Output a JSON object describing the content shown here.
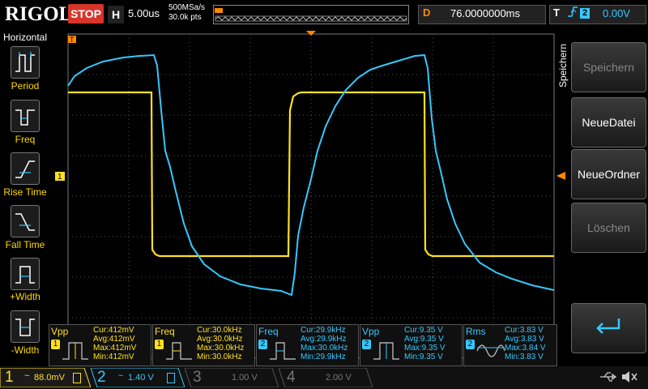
{
  "header": {
    "brand": "RIGOL",
    "run_state": "STOP",
    "timebase_label": "H",
    "timebase": "5.00us",
    "sample_rate": "500MSa/s",
    "memory_depth": "30.0k pts",
    "delay_label": "D",
    "delay_value": "76.0000000ms",
    "trigger_label": "T",
    "trigger_source": "2",
    "trigger_level": "0.00V"
  },
  "left_menu": {
    "title": "Horizontal",
    "items": [
      {
        "label": "Period",
        "icon": "period-icon"
      },
      {
        "label": "Freq",
        "icon": "frequency-icon"
      },
      {
        "label": "Rise Time",
        "icon": "rise-time-icon"
      },
      {
        "label": "Fall Time",
        "icon": "fall-time-icon"
      },
      {
        "label": "+Width",
        "icon": "positive-width-icon"
      },
      {
        "label": "-Width",
        "icon": "negative-width-icon"
      }
    ]
  },
  "right_menu": {
    "title": "Speichern",
    "items": [
      {
        "label": "Speichern",
        "enabled": false
      },
      {
        "label": "NeueDatei",
        "enabled": true
      },
      {
        "label": "NeueOrdner",
        "enabled": true
      },
      {
        "label": "Löschen",
        "enabled": false
      }
    ],
    "return_icon": "return-arrow-icon"
  },
  "markers": {
    "ch1_ref": "1",
    "trig_pos": "T"
  },
  "measurements": [
    {
      "name": "Vpp",
      "ch": "1",
      "cur": "Cur:412mV",
      "avg": "Avg:412mV",
      "max": "Max:412mV",
      "min": "Min:412mV",
      "icon": "vpp-icon"
    },
    {
      "name": "Freq",
      "ch": "1",
      "cur": "Cur:30.0kHz",
      "avg": "Avg:30.0kHz",
      "max": "Max:30.0kHz",
      "min": "Min:30.0kHz",
      "icon": "freq-icon"
    },
    {
      "name": "Freq",
      "ch": "2",
      "cur": "Cur:29.9kHz",
      "avg": "Avg:29.9kHz",
      "max": "Max:30.0kHz",
      "min": "Min:29.9kHz",
      "icon": "freq-icon"
    },
    {
      "name": "Vpp",
      "ch": "2",
      "cur": "Cur:9.35 V",
      "avg": "Avg:9.35 V",
      "max": "Max:9.35 V",
      "min": "Min:9.35 V",
      "icon": "vpp-icon"
    },
    {
      "name": "Rms",
      "ch": "2",
      "cur": "Cur:3.83 V",
      "avg": "Avg:3.83 V",
      "max": "Max:3.84 V",
      "min": "Min:3.83 V",
      "icon": "rms-icon"
    }
  ],
  "channels": [
    {
      "num": "1",
      "coupling": "~",
      "scale": "88.0mV",
      "color": "#ffe020",
      "active": true
    },
    {
      "num": "2",
      "coupling": "~",
      "scale": "1.40 V",
      "color": "#36c8ff",
      "active": true
    },
    {
      "num": "3",
      "coupling": "",
      "scale": "1.00 V",
      "color": "#555555",
      "active": false
    },
    {
      "num": "4",
      "coupling": "",
      "scale": "2.00 V",
      "color": "#555555",
      "active": false
    }
  ],
  "status_icons": [
    "usb-icon",
    "mute-icon"
  ],
  "colors": {
    "ch1": "#ffe020",
    "ch2": "#36c8ff",
    "stop": "#d8352a",
    "trigger_marker": "#ff8800"
  }
}
